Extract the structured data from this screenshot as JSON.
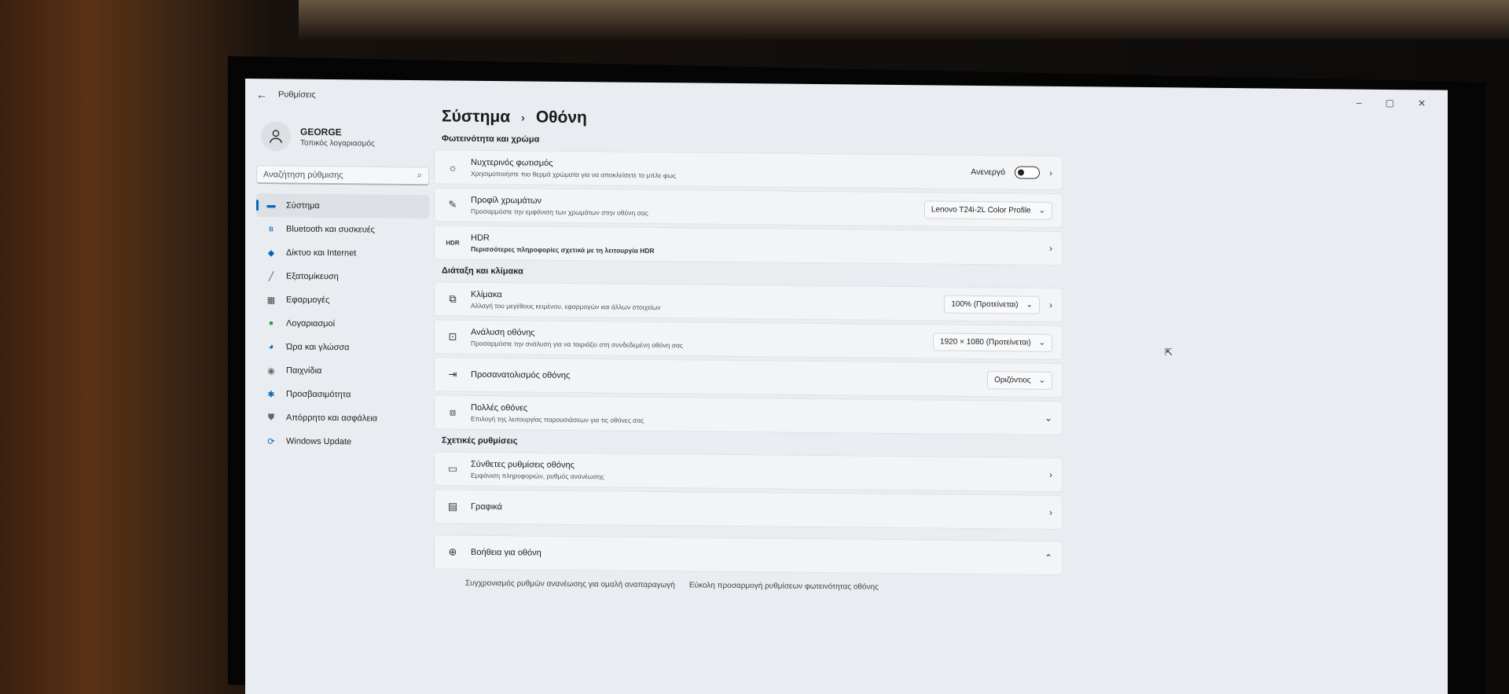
{
  "window": {
    "title": "Ρυθμίσεις",
    "controls": [
      "–",
      "▢",
      "✕"
    ]
  },
  "profile": {
    "name": "GEORGE",
    "account_type": "Τοπικός λογαριασμός"
  },
  "search": {
    "placeholder": "Αναζήτηση ρύθμισης"
  },
  "nav": {
    "items": [
      {
        "label": "Σύστημα",
        "icon": "monitor-icon",
        "active": true
      },
      {
        "label": "Bluetooth και συσκευές",
        "icon": "bluetooth-icon"
      },
      {
        "label": "Δίκτυο και Internet",
        "icon": "wifi-icon"
      },
      {
        "label": "Εξατομίκευση",
        "icon": "pen-icon"
      },
      {
        "label": "Εφαρμογές",
        "icon": "apps-icon"
      },
      {
        "label": "Λογαριασμοί",
        "icon": "person-icon"
      },
      {
        "label": "Ώρα και γλώσσα",
        "icon": "globe-clock-icon"
      },
      {
        "label": "Παιχνίδια",
        "icon": "gamepad-icon"
      },
      {
        "label": "Προσβασιμότητα",
        "icon": "accessibility-icon"
      },
      {
        "label": "Απόρρητο και ασφάλεια",
        "icon": "shield-icon"
      },
      {
        "label": "Windows Update",
        "icon": "update-icon"
      }
    ]
  },
  "breadcrumb": {
    "parent": "Σύστημα",
    "separator": "›",
    "current": "Οθόνη"
  },
  "sections": {
    "brightness_color": {
      "title": "Φωτεινότητα και χρώμα",
      "night_light": {
        "title": "Νυχτερινός φωτισμός",
        "desc": "Χρησιμοποιήστε πιο θερμά χρώματα για να αποκλείσετε το μπλε φως",
        "status": "Ανενεργό"
      },
      "color_profile": {
        "title": "Προφίλ χρωμάτων",
        "desc": "Προσαρμόστε την εμφάνιση των χρωμάτων στην οθόνη σας",
        "value": "Lenovo T24i-2L Color Profile"
      },
      "hdr": {
        "title": "HDR",
        "desc": "Περισσότερες πληροφορίες σχετικά με τη λειτουργία HDR"
      }
    },
    "layout_scale": {
      "title": "Διάταξη και κλίμακα",
      "scale": {
        "title": "Κλίμακα",
        "desc": "Αλλαγή του μεγέθους κειμένου, εφαρμογών και άλλων στοιχείων",
        "value": "100% (Προτείνεται)"
      },
      "resolution": {
        "title": "Ανάλυση οθόνης",
        "desc": "Προσαρμόστε την ανάλυση για να ταιριάζει στη συνδεδεμένη οθόνη σας",
        "value": "1920 × 1080 (Προτείνεται)"
      },
      "orientation": {
        "title": "Προσανατολισμός οθόνης",
        "value": "Οριζόντιος"
      },
      "multiple": {
        "title": "Πολλές οθόνες",
        "desc": "Επιλογή της λειτουργίας παρουσιάσεων για τις οθόνες σας"
      }
    },
    "related": {
      "title": "Σχετικές ρυθμίσεις",
      "advanced": {
        "title": "Σύνθετες ρυθμίσεις οθόνης",
        "desc": "Εμφάνιση πληροφοριών, ρυθμός ανανέωσης"
      },
      "graphics": {
        "title": "Γραφικά"
      }
    },
    "help": {
      "title": "Βοήθεια για οθόνη",
      "links": [
        "Συγχρονισμός ρυθμών ανανέωσης για ομαλή αναπαραγωγή",
        "Εύκολη προσαρμογή ρυθμίσεων φωτεινότητας οθόνης"
      ]
    }
  }
}
